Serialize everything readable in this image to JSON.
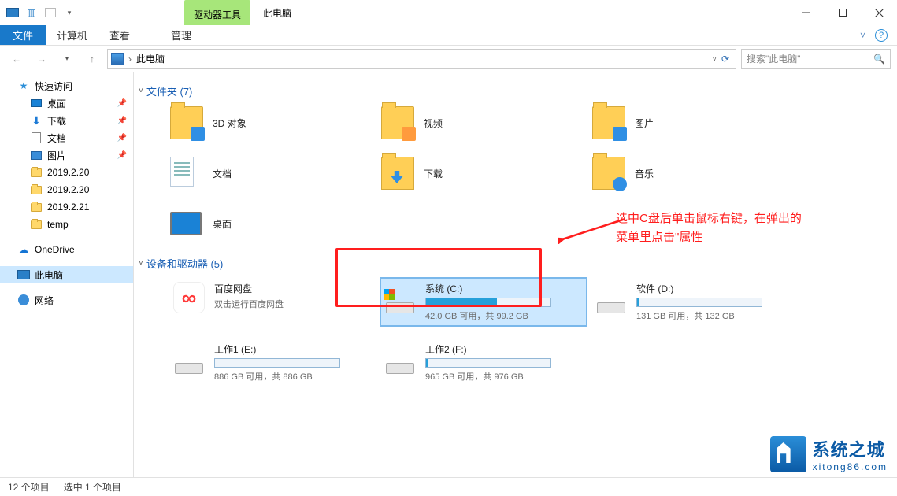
{
  "titlebar": {
    "drive_tools": "驱动器工具",
    "title": "此电脑"
  },
  "ribbon": {
    "file": "文件",
    "computer": "计算机",
    "view": "查看",
    "manage": "管理"
  },
  "address": {
    "location": "此电脑",
    "search_placeholder": "搜索\"此电脑\""
  },
  "sidebar": {
    "quick_access": "快速访问",
    "desktop": "桌面",
    "downloads": "下载",
    "documents": "文档",
    "pictures": "图片",
    "f1": "2019.2.20",
    "f2": "2019.2.20",
    "f3": "2019.2.21",
    "f4": "temp",
    "onedrive": "OneDrive",
    "this_pc": "此电脑",
    "network": "网络"
  },
  "sections": {
    "folders": "文件夹 (7)",
    "devices": "设备和驱动器 (5)"
  },
  "folders": {
    "objects3d": "3D 对象",
    "videos": "视频",
    "pictures": "图片",
    "documents": "文档",
    "downloads": "下载",
    "music": "音乐",
    "desktop": "桌面"
  },
  "devices": {
    "baidu_name": "百度网盘",
    "baidu_sub": "双击运行百度网盘",
    "c_name": "系统 (C:)",
    "c_cap": "42.0 GB 可用，共 99.2 GB",
    "c_fill_pct": 57,
    "d_name": "软件 (D:)",
    "d_cap": "131 GB 可用，共 132 GB",
    "d_fill_pct": 1,
    "e_name": "工作1 (E:)",
    "e_cap": "886 GB 可用，共 886 GB",
    "e_fill_pct": 0,
    "f_name": "工作2 (F:)",
    "f_cap": "965 GB 可用，共 976 GB",
    "f_fill_pct": 1
  },
  "annotation": {
    "line1": "选中C盘后单击鼠标右键，在弹出的",
    "line2": "菜单里点击\"属性"
  },
  "status": {
    "items": "12 个项目",
    "selected": "选中 1 个项目"
  },
  "watermark": {
    "title": "系统之城",
    "url": "xitong86.com"
  }
}
